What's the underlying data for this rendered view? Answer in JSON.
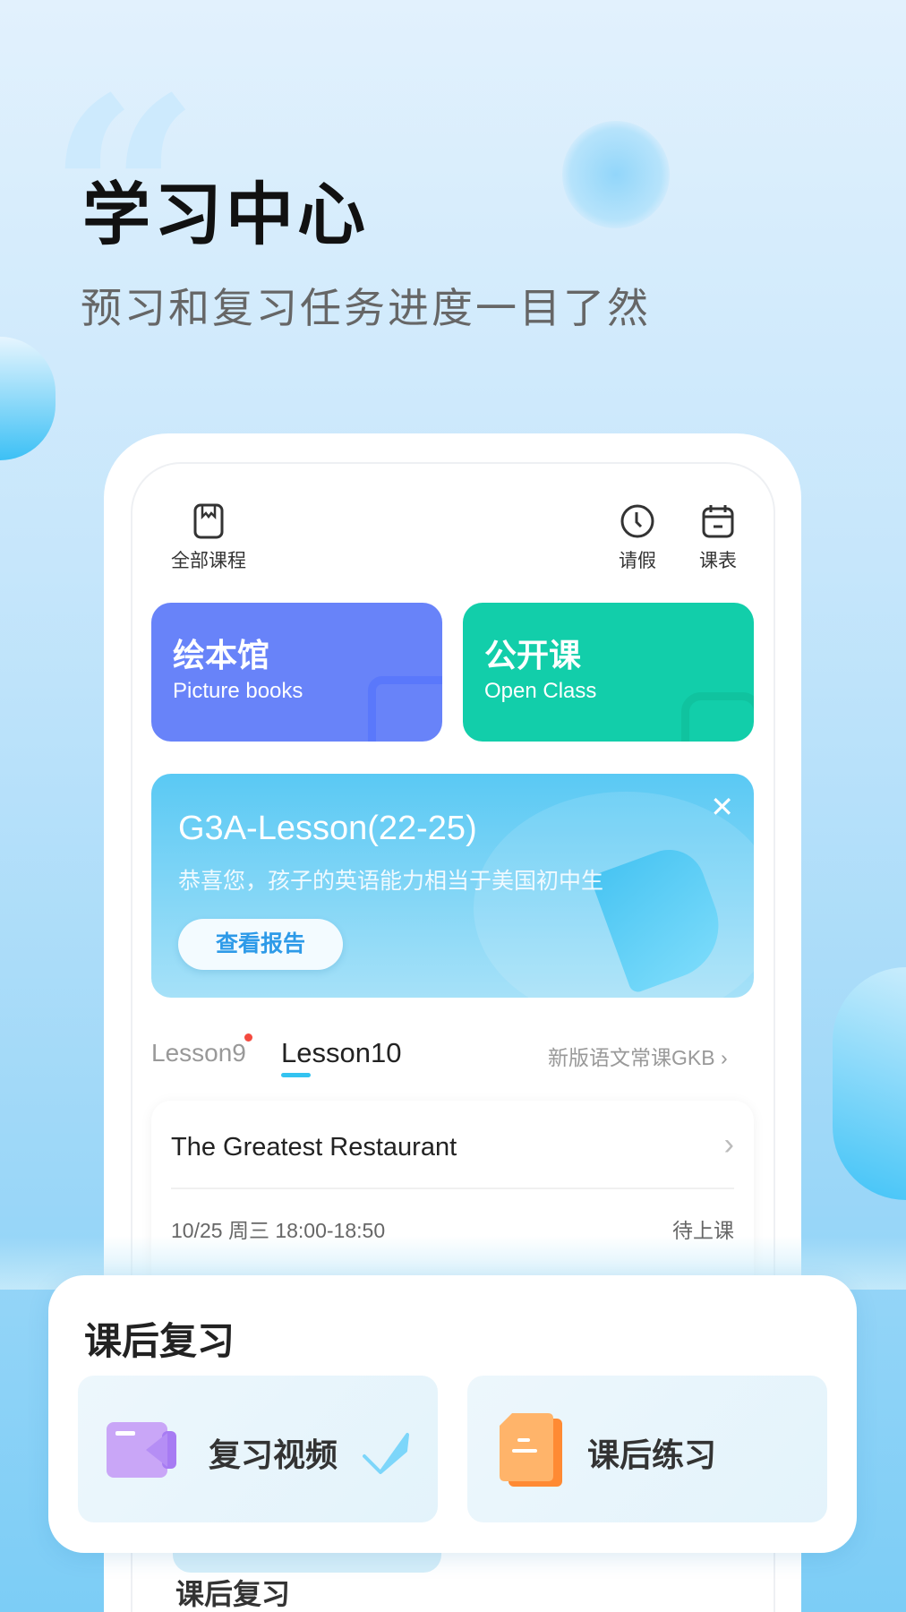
{
  "header": {
    "title": "学习中心",
    "subtitle": "预习和复习任务进度一目了然"
  },
  "top_icons": [
    {
      "label": "全部课程",
      "icon": "bookmark-book-icon"
    },
    {
      "label": "请假",
      "icon": "clock-icon"
    },
    {
      "label": "课表",
      "icon": "calendar-icon"
    }
  ],
  "cards": [
    {
      "title": "绘本馆",
      "subtitle": "Picture books",
      "color": "#6883f9"
    },
    {
      "title": "公开课",
      "subtitle": "Open Class",
      "color": "#12ceaa"
    }
  ],
  "banner": {
    "title": "G3A-Lesson(22-25)",
    "message": "恭喜您，孩子的英语能力相当于美国初中生",
    "button": "查看报告",
    "close_icon": "close-icon"
  },
  "tabs": {
    "items": [
      {
        "label": "Lesson9",
        "has_dot": true
      },
      {
        "label": "Lesson10",
        "active": true
      }
    ],
    "course_link": "新版语文常课GKB"
  },
  "lesson": {
    "title": "The Greatest Restaurant",
    "time": "10/25 周三 18:00-18:50",
    "status": "待上课"
  },
  "review": {
    "title": "课后复习",
    "items": [
      {
        "label": "复习视频",
        "icon": "video-camera-icon",
        "done": true
      },
      {
        "label": "课后练习",
        "icon": "document-icon",
        "done": false
      }
    ]
  },
  "behind_text": "课后复习",
  "colors": {
    "accent": "#33c3f0",
    "dot": "#f44a3f"
  }
}
